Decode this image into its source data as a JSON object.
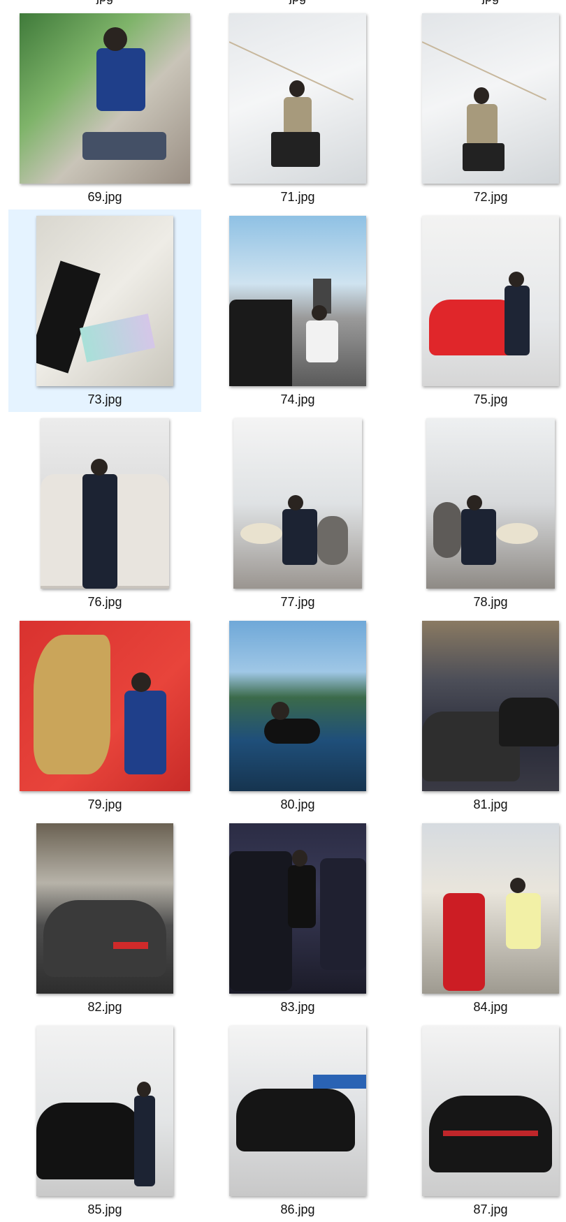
{
  "files": [
    {
      "name": "69.jpg",
      "selected": false
    },
    {
      "name": "71.jpg",
      "selected": false
    },
    {
      "name": "72.jpg",
      "selected": false
    },
    {
      "name": "73.jpg",
      "selected": true
    },
    {
      "name": "74.jpg",
      "selected": false
    },
    {
      "name": "75.jpg",
      "selected": false
    },
    {
      "name": "76.jpg",
      "selected": false
    },
    {
      "name": "77.jpg",
      "selected": false
    },
    {
      "name": "78.jpg",
      "selected": false
    },
    {
      "name": "79.jpg",
      "selected": false
    },
    {
      "name": "80.jpg",
      "selected": false
    },
    {
      "name": "81.jpg",
      "selected": false
    },
    {
      "name": "82.jpg",
      "selected": false
    },
    {
      "name": "83.jpg",
      "selected": false
    },
    {
      "name": "84.jpg",
      "selected": false
    },
    {
      "name": "85.jpg",
      "selected": false
    },
    {
      "name": "86.jpg",
      "selected": false
    },
    {
      "name": "87.jpg",
      "selected": false
    }
  ],
  "partial_top_captions": [
    "jpg",
    "jpg",
    "jpg"
  ],
  "colors": {
    "selection_bg": "#e5f3ff",
    "caption_text": "#111111"
  }
}
